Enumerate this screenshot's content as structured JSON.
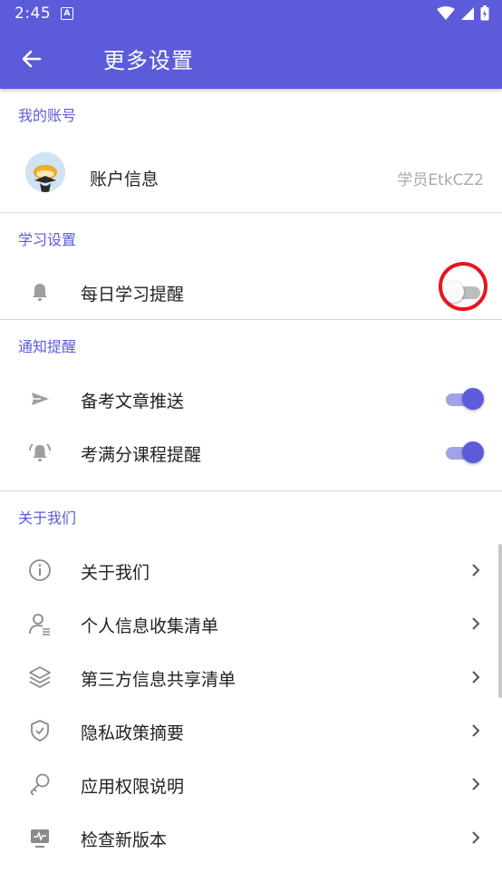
{
  "status_bar": {
    "time": "2:45",
    "notif_letter": "A"
  },
  "app_bar": {
    "title": "更多设置",
    "back_icon": "arrow-back-icon"
  },
  "sections": {
    "account": {
      "header": "我的账号",
      "row": {
        "label": "账户信息",
        "value": "学员EtkCZ2"
      }
    },
    "study": {
      "header": "学习设置",
      "rows": [
        {
          "label": "每日学习提醒",
          "icon": "bell-icon",
          "toggle_on": false
        }
      ]
    },
    "notify": {
      "header": "通知提醒",
      "rows": [
        {
          "label": "备考文章推送",
          "icon": "send-icon",
          "toggle_on": true
        },
        {
          "label": "考满分课程提醒",
          "icon": "alarm-bell-icon",
          "toggle_on": true
        }
      ]
    },
    "about": {
      "header": "关于我们",
      "rows": [
        {
          "label": "关于我们",
          "icon": "info-icon"
        },
        {
          "label": "个人信息收集清单",
          "icon": "person-list-icon"
        },
        {
          "label": "第三方信息共享清单",
          "icon": "layers-icon"
        },
        {
          "label": "隐私政策摘要",
          "icon": "shield-check-icon"
        },
        {
          "label": "应用权限说明",
          "icon": "key-icon"
        },
        {
          "label": "检查新版本",
          "icon": "monitor-pulse-icon"
        }
      ]
    }
  },
  "colors": {
    "primary": "#5c5bd9",
    "toggle_on_track": "#a3a2e6",
    "highlight": "#e8141c"
  }
}
